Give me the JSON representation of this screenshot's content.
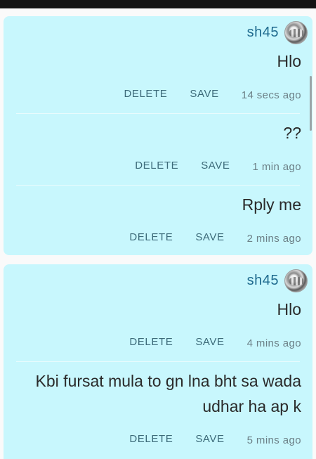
{
  "cards": [
    {
      "username": "sh45",
      "messages": [
        {
          "text": "Hlo",
          "delete_label": "DELETE",
          "save_label": "SAVE",
          "time": "14 secs ago"
        },
        {
          "text": "??",
          "delete_label": "DELETE",
          "save_label": "SAVE",
          "time": "1 min ago"
        },
        {
          "text": "Rply me",
          "delete_label": "DELETE",
          "save_label": "SAVE",
          "time": "2 mins ago"
        }
      ]
    },
    {
      "username": "sh45",
      "messages": [
        {
          "text": "Hlo",
          "delete_label": "DELETE",
          "save_label": "SAVE",
          "time": "4 mins ago"
        },
        {
          "text": "Kbi fursat mula to gn lna bht sa wada udhar ha ap k",
          "delete_label": "DELETE",
          "save_label": "SAVE",
          "time": "5 mins ago"
        }
      ]
    }
  ]
}
